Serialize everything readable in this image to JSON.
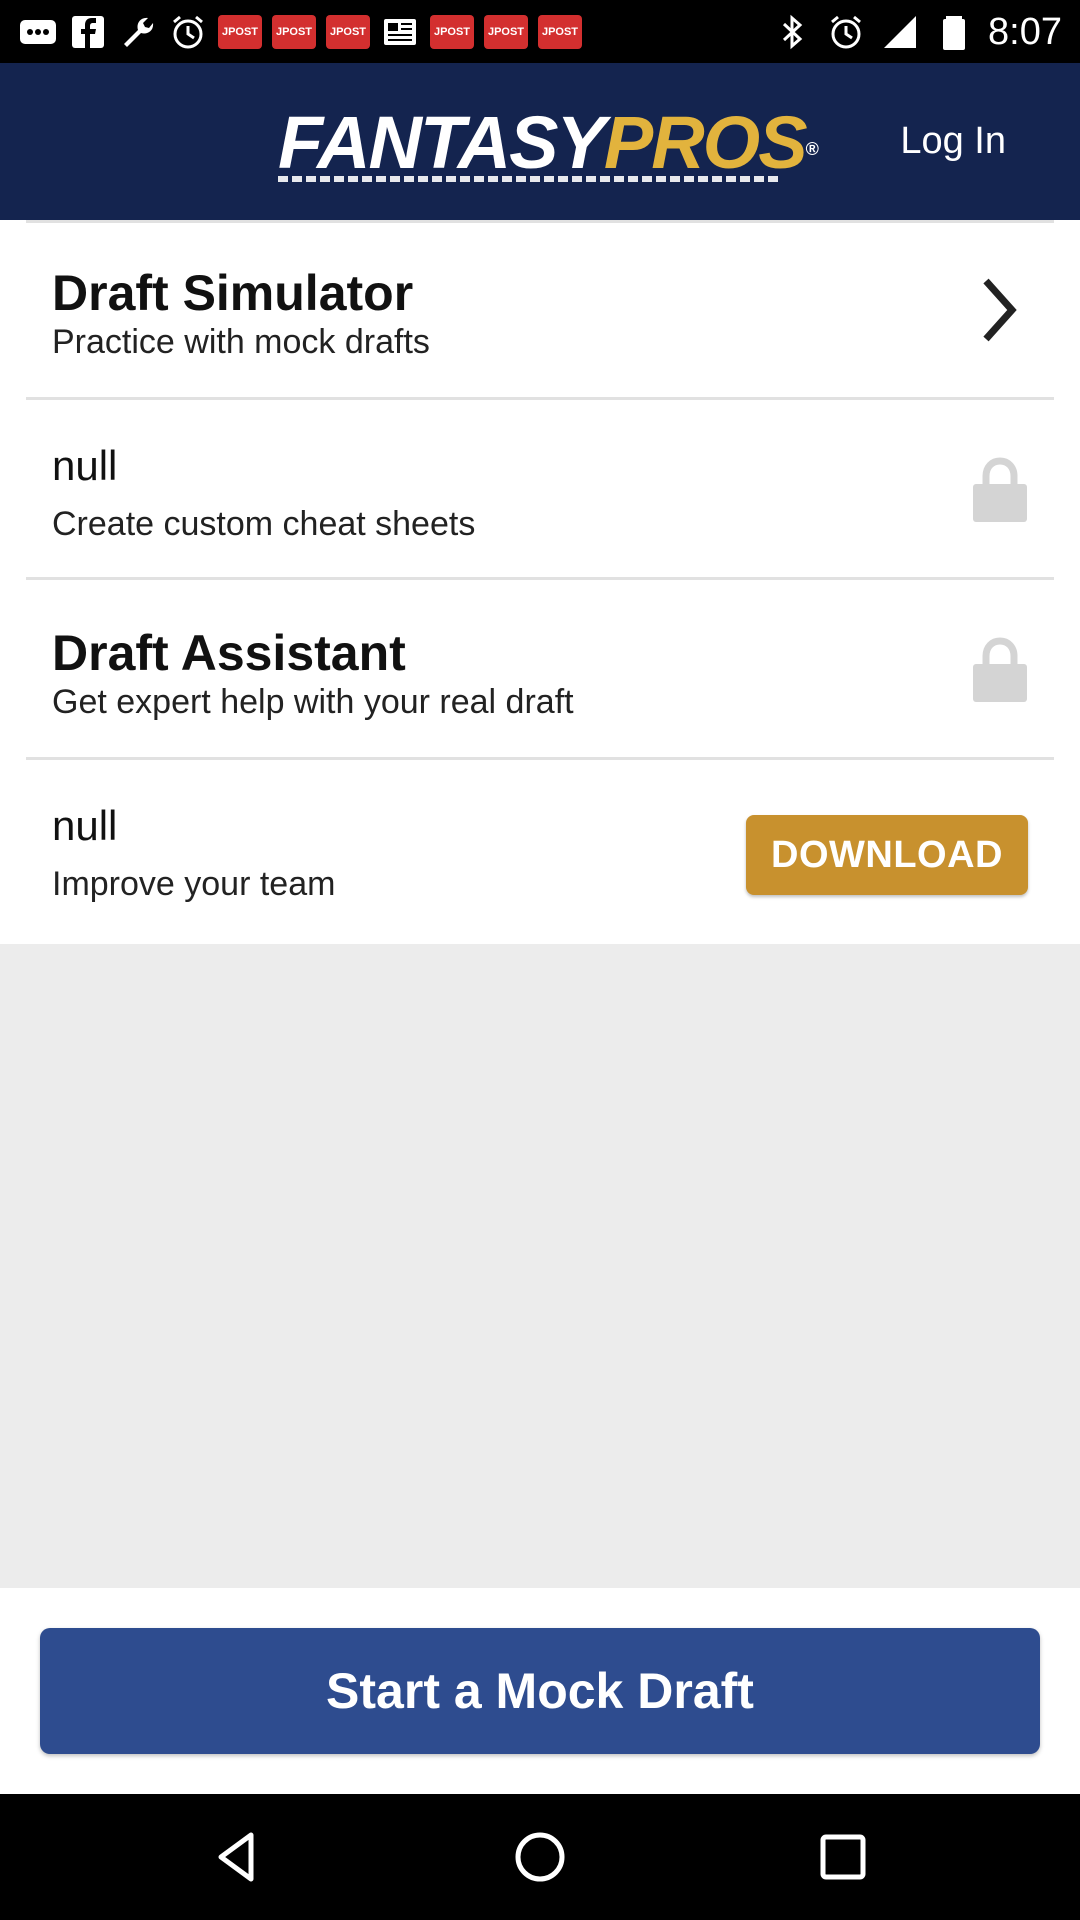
{
  "status_bar": {
    "time": "8:07",
    "left_icons": [
      "more-icon",
      "facebook-icon",
      "wrench-icon",
      "alarm-icon",
      "jpost-icon",
      "jpost-icon",
      "jpost-icon",
      "news-icon",
      "jpost-icon",
      "jpost-icon",
      "jpost-icon"
    ],
    "jpost_label": "JPOST",
    "right_icons": [
      "bluetooth-icon",
      "alarm-icon",
      "signal-icon",
      "battery-icon"
    ]
  },
  "header": {
    "logo_part1": "FANTASY",
    "logo_part2": "PROS",
    "logo_reg": "®",
    "login_label": "Log In"
  },
  "items": [
    {
      "title": "Draft Simulator",
      "subtitle": "Practice with mock drafts",
      "action": "chevron-right-icon"
    },
    {
      "title": "null",
      "subtitle": "Create custom cheat sheets",
      "action": "lock-icon"
    },
    {
      "title": "Draft Assistant",
      "subtitle": "Get expert help with your real draft",
      "action": "lock-icon"
    },
    {
      "title": "null",
      "subtitle": "Improve your team",
      "action": "download-button",
      "download_label": "DOWNLOAD"
    }
  ],
  "cta": {
    "label": "Start a Mock Draft"
  },
  "nav": {
    "icons": [
      "back-icon",
      "home-icon",
      "recents-icon"
    ]
  },
  "colors": {
    "header_bg": "#14244f",
    "logo_accent": "#e2b33d",
    "download_bg": "#c8912e",
    "cta_bg": "#2e4c8f",
    "page_bg": "#ececec"
  }
}
